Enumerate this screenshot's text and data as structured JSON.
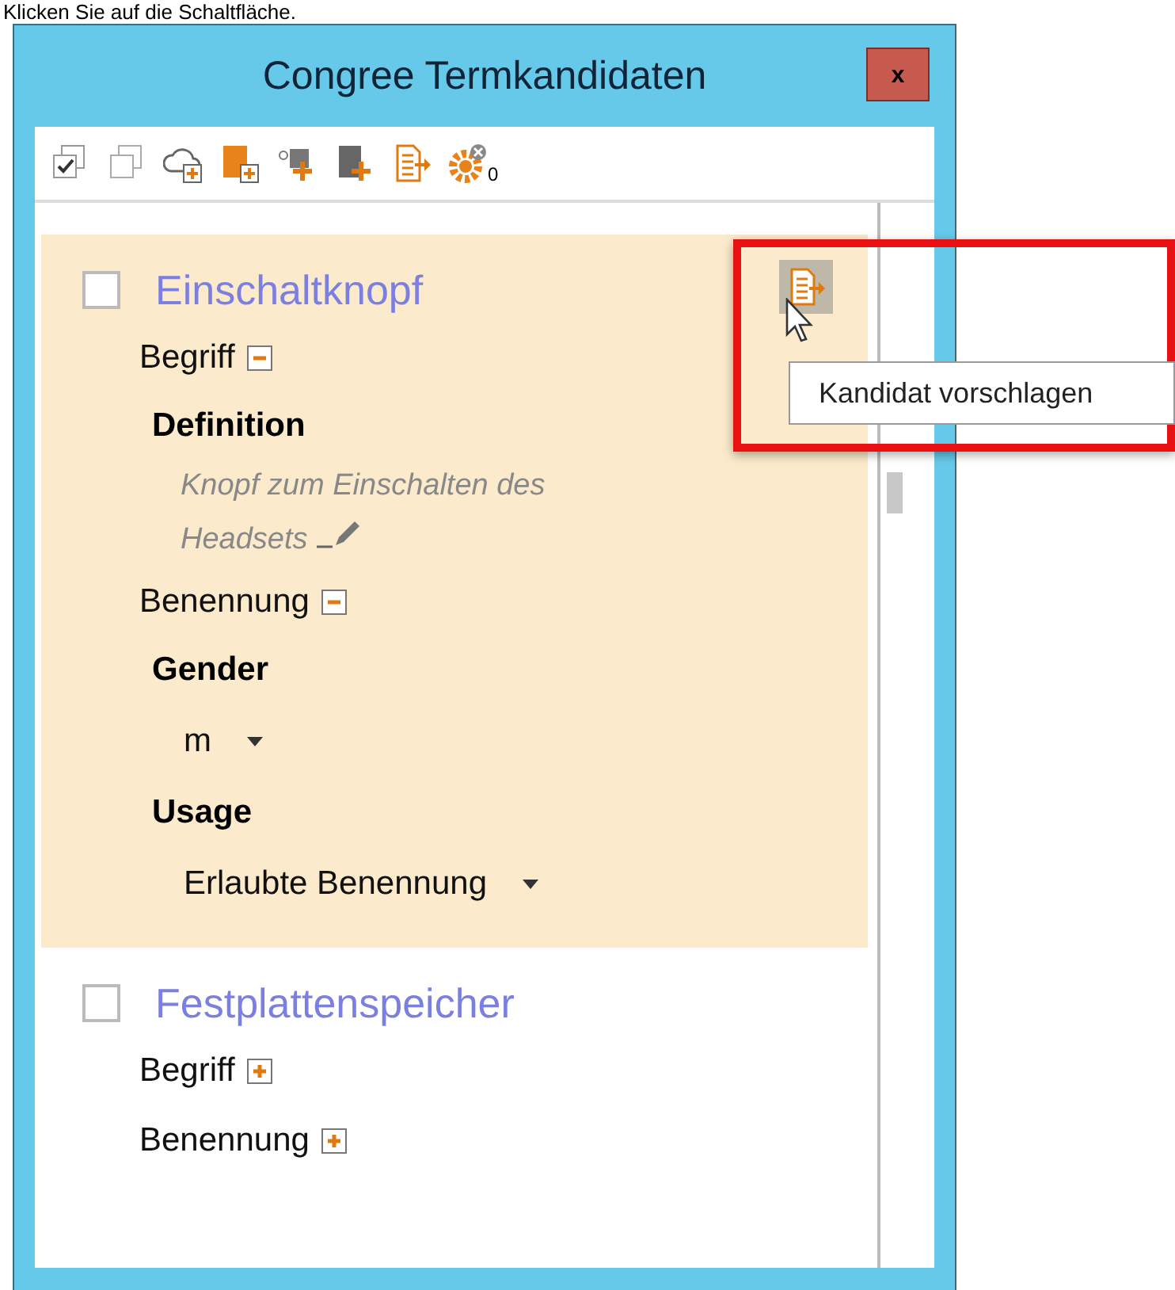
{
  "caption": "Klicken Sie auf die Schaltfläche.",
  "window": {
    "title": "Congree Termkandidaten",
    "close": "x"
  },
  "toolbar": {
    "counter": "0"
  },
  "candidates": [
    {
      "name": "Einschaltknopf",
      "checked": false,
      "selected": true,
      "sections": [
        {
          "label": "Begriff",
          "expanded": true,
          "fields": [
            {
              "kind": "text",
              "label": "Definition",
              "value": "Knopf zum Einschalten des Headsets"
            }
          ]
        },
        {
          "label": "Benennung",
          "expanded": true,
          "fields": [
            {
              "kind": "select",
              "label": "Gender",
              "value": "m"
            },
            {
              "kind": "select",
              "label": "Usage",
              "value": "Erlaubte Benennung"
            }
          ]
        }
      ]
    },
    {
      "name": "Festplattenspeicher",
      "checked": false,
      "selected": false,
      "sections": [
        {
          "label": "Begriff",
          "expanded": false
        },
        {
          "label": "Benennung",
          "expanded": false
        }
      ]
    }
  ],
  "tooltip": "Kandidat vorschlagen"
}
